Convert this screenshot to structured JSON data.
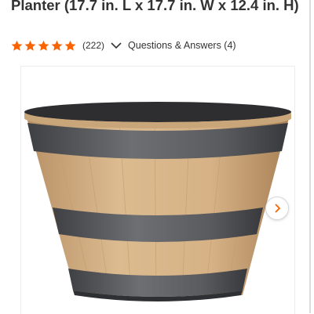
{
  "product": {
    "title": "Planter (17.7 in. L x 17.7 in. W x 12.4 in. H)",
    "rating_stars": 5,
    "review_count": "(222)",
    "qa_label": "Questions & Answers (4)"
  },
  "colors": {
    "star": "#f96302",
    "text": "#333333",
    "wood_light": "#d9b88c",
    "wood_dark": "#b08a5f",
    "band": "#55565a"
  },
  "icons": {
    "star": "star-icon",
    "chevron": "chevron-down-icon",
    "next": "chevron-right-icon"
  }
}
